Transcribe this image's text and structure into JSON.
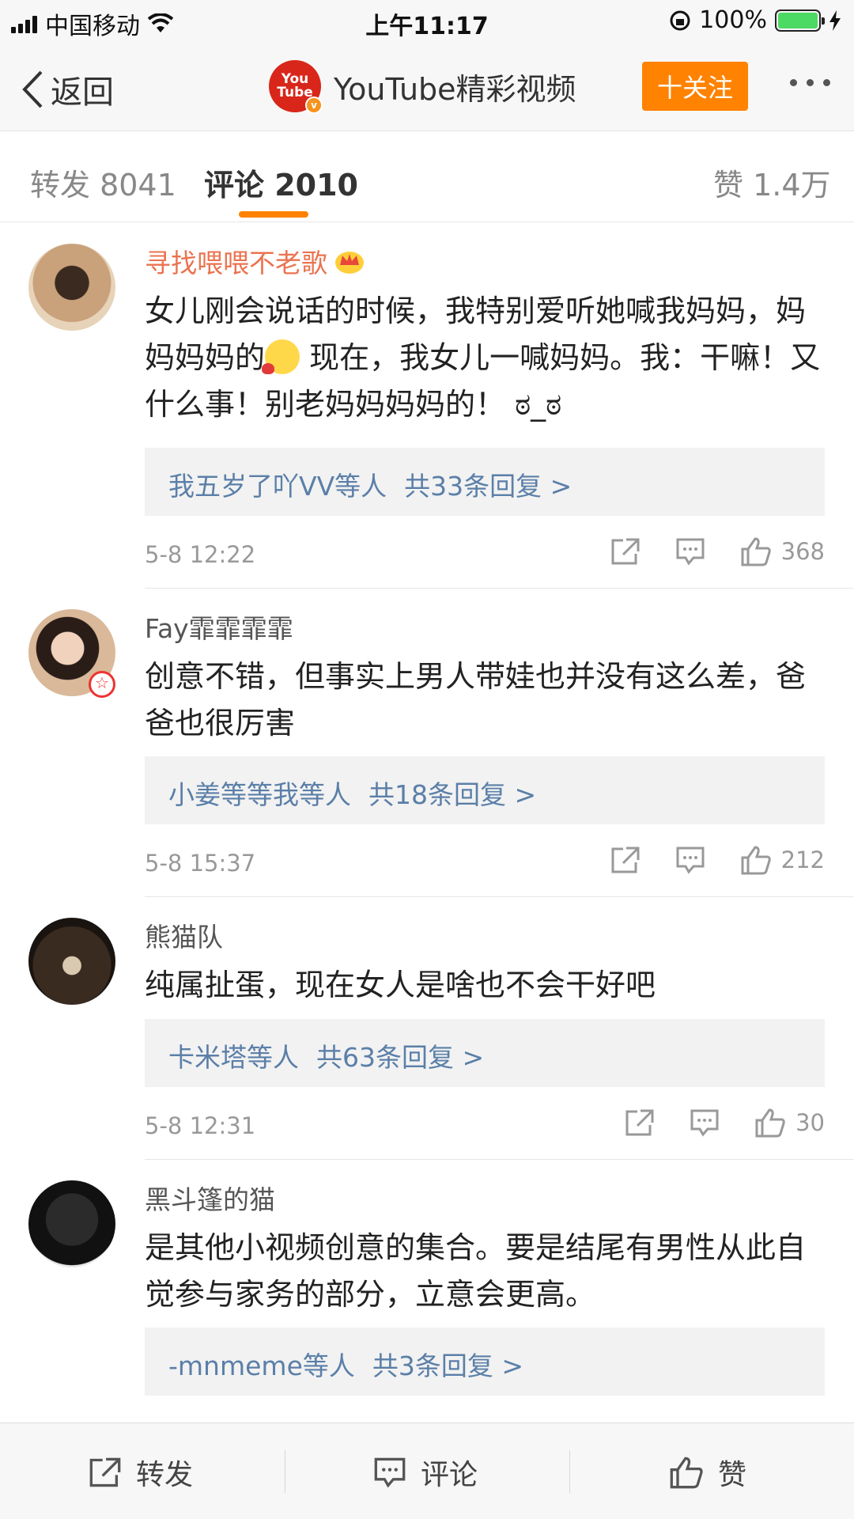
{
  "status_bar": {
    "carrier": "中国移动",
    "time": "上午11:17",
    "battery": "100%"
  },
  "nav": {
    "back_label": "返回",
    "account_name": "YouTube精彩视频",
    "logo_text_top": "You",
    "logo_text_bottom": "Tube",
    "follow_label": "十关注"
  },
  "tabs": {
    "repost": "转发 8041",
    "comments": "评论 2010",
    "likes": "赞 1.4万"
  },
  "comments": [
    {
      "name": "寻找喂喂不老歌",
      "text_a": "女儿刚会说话的时候，我特别爱听她喊我妈妈，妈妈妈妈的",
      "text_b": " 现在，我女儿一喊妈妈。我：干嘛！又什么事！别老妈妈妈妈的！ ಠ_ಠ",
      "reply_users": "我五岁了吖VV等人",
      "reply_count": "共33条回复 >",
      "time": "5-8 12:22",
      "likes": "368"
    },
    {
      "name": "Fay霏霏霏霏",
      "text": "创意不错，但事实上男人带娃也并没有这么差，爸爸也很厉害",
      "reply_users": "小姜等等我等人",
      "reply_count": "共18条回复 >",
      "time": "5-8 15:37",
      "likes": "212"
    },
    {
      "name": "熊猫队",
      "text": "纯属扯蛋，现在女人是啥也不会干好吧",
      "reply_users": "卡米塔等人",
      "reply_count": "共63条回复 >",
      "time": "5-8 12:31",
      "likes": "30"
    },
    {
      "name": "黑斗篷的猫",
      "text": "是其他小视频创意的集合。要是结尾有男性从此自觉参与家务的部分，立意会更高。",
      "reply_users": "-mnmeme等人",
      "reply_count": "共3条回复 >"
    }
  ],
  "bottom_bar": {
    "repost": "转发",
    "comment": "评论",
    "like": "赞"
  },
  "colors": {
    "accent": "#ff8200",
    "link": "#5b7fa8",
    "vip_name": "#eb7350"
  },
  "icons": [
    "back-chevron-icon",
    "wifi-icon",
    "battery-icon",
    "share-icon",
    "comment-icon",
    "thumbs-up-icon",
    "more-icon"
  ]
}
